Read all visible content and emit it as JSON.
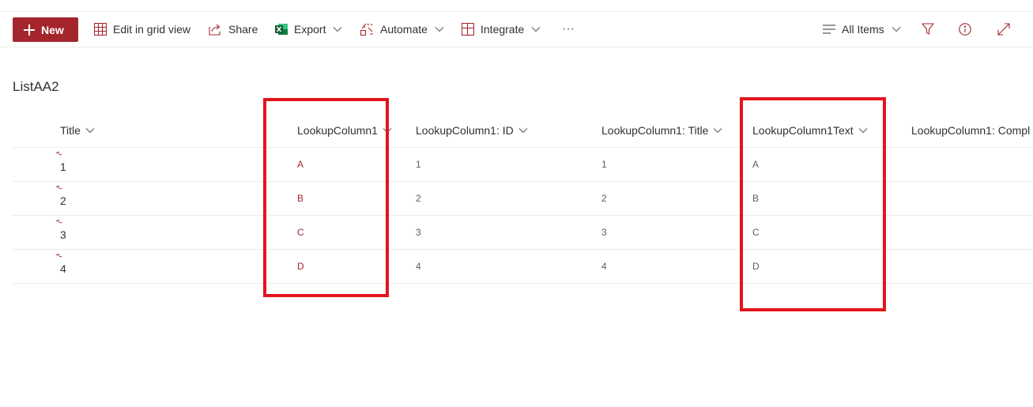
{
  "colors": {
    "brand": "#a4262c",
    "highlight": "#e3141e",
    "excel": "#217346"
  },
  "toolbar": {
    "new_label": "New",
    "edit_grid_label": "Edit in grid view",
    "share_label": "Share",
    "export_label": "Export",
    "automate_label": "Automate",
    "integrate_label": "Integrate",
    "more_label": "···",
    "view_label": "All Items"
  },
  "list": {
    "title": "ListAA2",
    "columns": [
      "Title",
      "LookupColumn1",
      "LookupColumn1: ID",
      "LookupColumn1: Title",
      "LookupColumn1Text",
      "LookupColumn1: Compl"
    ],
    "rows": [
      {
        "title": "1",
        "lookup": "A",
        "lookup_id": "1",
        "lookup_title": "1",
        "lookup_text": "A",
        "lookup_compl": ""
      },
      {
        "title": "2",
        "lookup": "B",
        "lookup_id": "2",
        "lookup_title": "2",
        "lookup_text": "B",
        "lookup_compl": ""
      },
      {
        "title": "3",
        "lookup": "C",
        "lookup_id": "3",
        "lookup_title": "3",
        "lookup_text": "C",
        "lookup_compl": ""
      },
      {
        "title": "4",
        "lookup": "D",
        "lookup_id": "4",
        "lookup_title": "4",
        "lookup_text": "D",
        "lookup_compl": ""
      }
    ]
  }
}
